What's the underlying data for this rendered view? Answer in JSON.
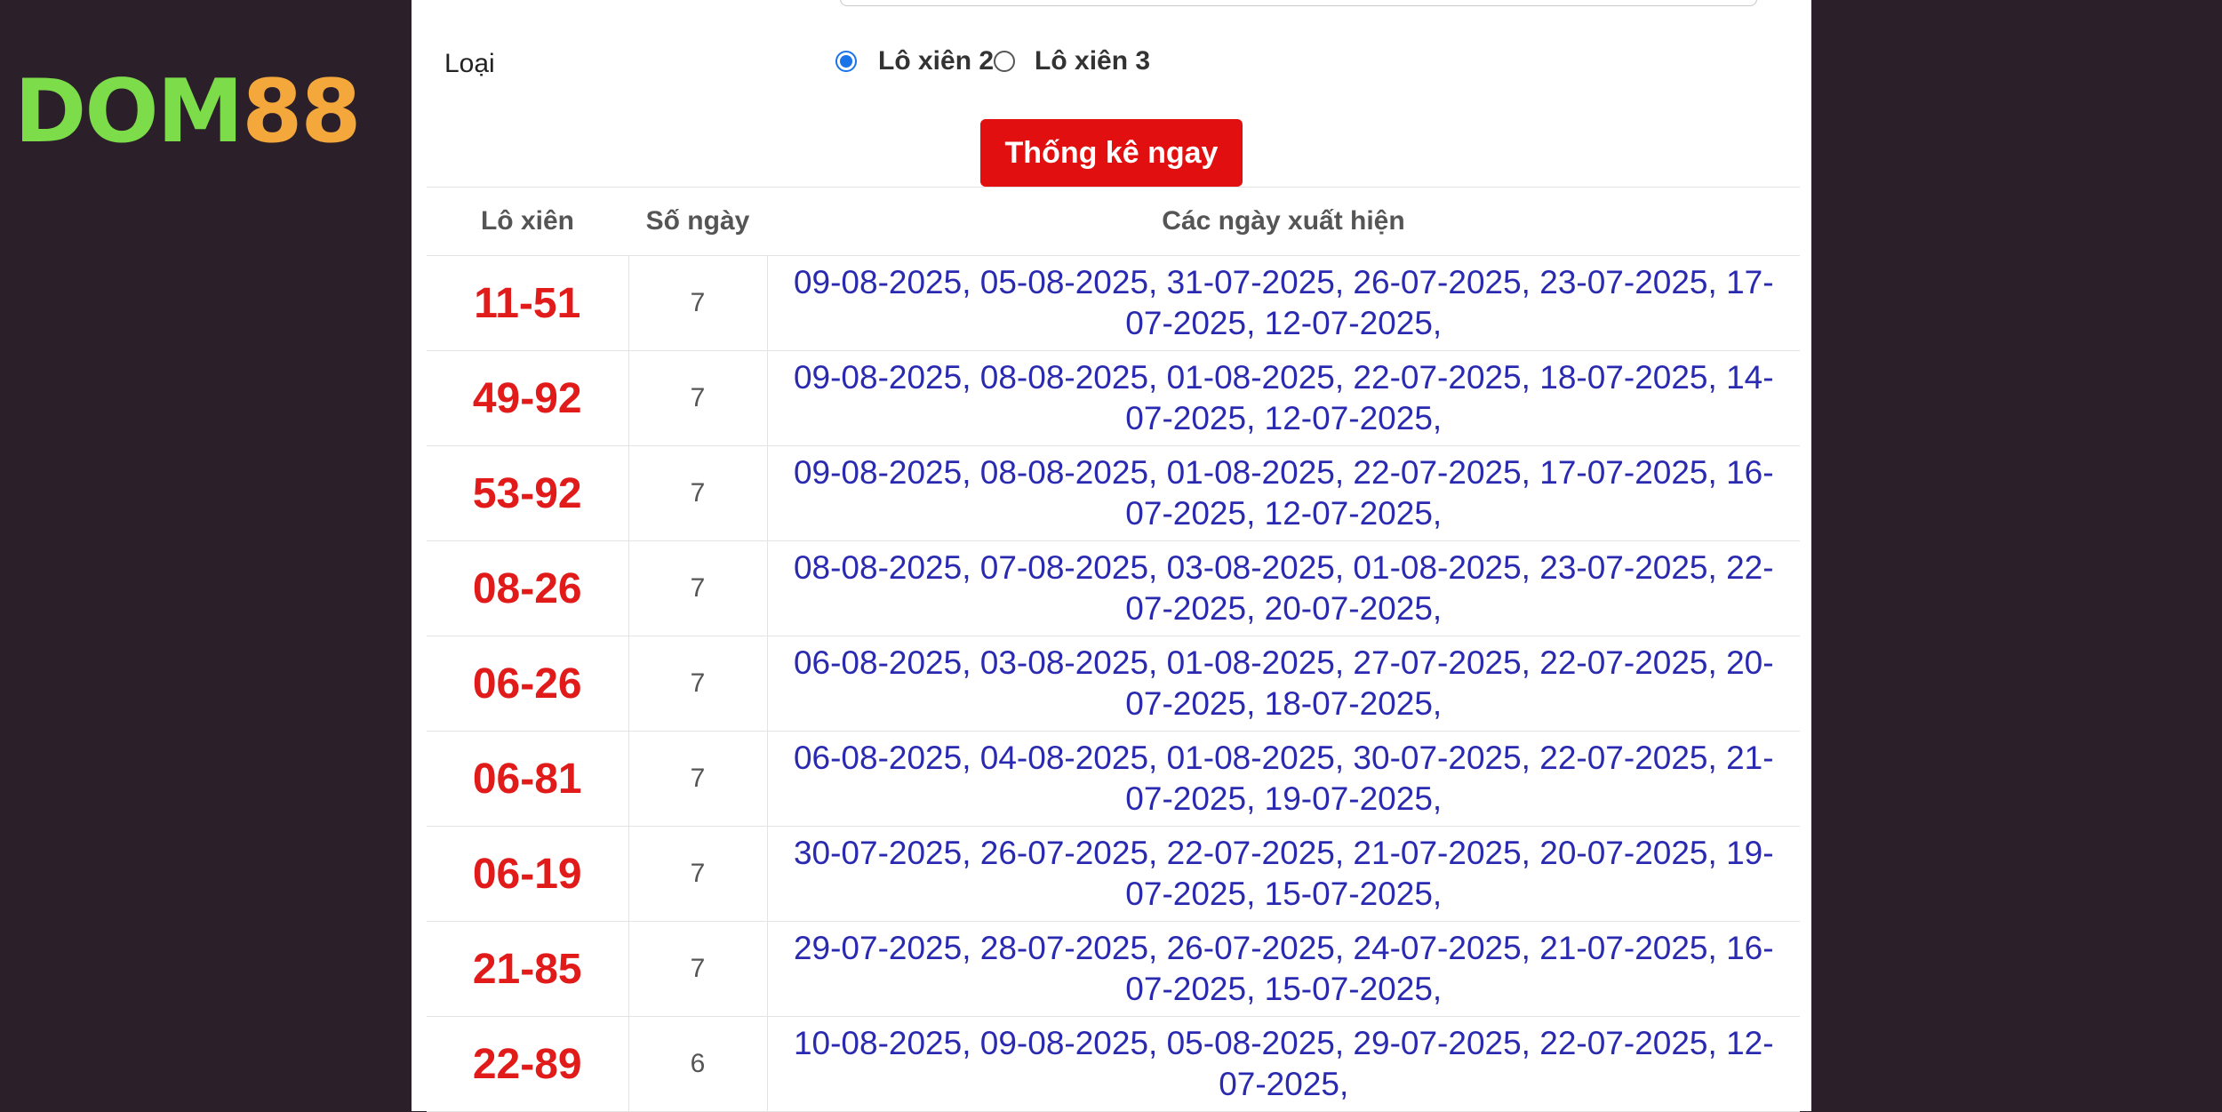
{
  "brand": {
    "logo_left": "DOM",
    "logo_right": "88"
  },
  "form": {
    "type_label": "Loại",
    "options": [
      "Lô xiên 2",
      "Lô xiên 3"
    ],
    "selected": "Lô xiên 2",
    "submit_label": "Thống kê ngay"
  },
  "table": {
    "headers": [
      "Lô xiên",
      "Số ngày",
      "Các ngày xuất hiện"
    ],
    "rows": [
      {
        "pair": "11-51",
        "days": "7",
        "dates": "09-08-2025, 05-08-2025, 31-07-2025, 26-07-2025, 23-07-2025, 17-07-2025, 12-07-2025,"
      },
      {
        "pair": "49-92",
        "days": "7",
        "dates": "09-08-2025, 08-08-2025, 01-08-2025, 22-07-2025, 18-07-2025, 14-07-2025, 12-07-2025,"
      },
      {
        "pair": "53-92",
        "days": "7",
        "dates": "09-08-2025, 08-08-2025, 01-08-2025, 22-07-2025, 17-07-2025, 16-07-2025, 12-07-2025,"
      },
      {
        "pair": "08-26",
        "days": "7",
        "dates": "08-08-2025, 07-08-2025, 03-08-2025, 01-08-2025, 23-07-2025, 22-07-2025, 20-07-2025,"
      },
      {
        "pair": "06-26",
        "days": "7",
        "dates": "06-08-2025, 03-08-2025, 01-08-2025, 27-07-2025, 22-07-2025, 20-07-2025, 18-07-2025,"
      },
      {
        "pair": "06-81",
        "days": "7",
        "dates": "06-08-2025, 04-08-2025, 01-08-2025, 30-07-2025, 22-07-2025, 21-07-2025, 19-07-2025,"
      },
      {
        "pair": "06-19",
        "days": "7",
        "dates": "30-07-2025, 26-07-2025, 22-07-2025, 21-07-2025, 20-07-2025, 19-07-2025, 15-07-2025,"
      },
      {
        "pair": "21-85",
        "days": "7",
        "dates": "29-07-2025, 28-07-2025, 26-07-2025, 24-07-2025, 21-07-2025, 16-07-2025, 15-07-2025,"
      },
      {
        "pair": "22-89",
        "days": "6",
        "dates": "10-08-2025, 09-08-2025, 05-08-2025, 29-07-2025, 22-07-2025, 12-07-2025,"
      }
    ]
  },
  "colors": {
    "background": "#2b1f29",
    "pair_text": "#e11a1a",
    "dates_text": "#2a2ab0",
    "button": "#e10f0f",
    "logo_green": "#7ddc4a",
    "logo_orange": "#f4a73a"
  }
}
